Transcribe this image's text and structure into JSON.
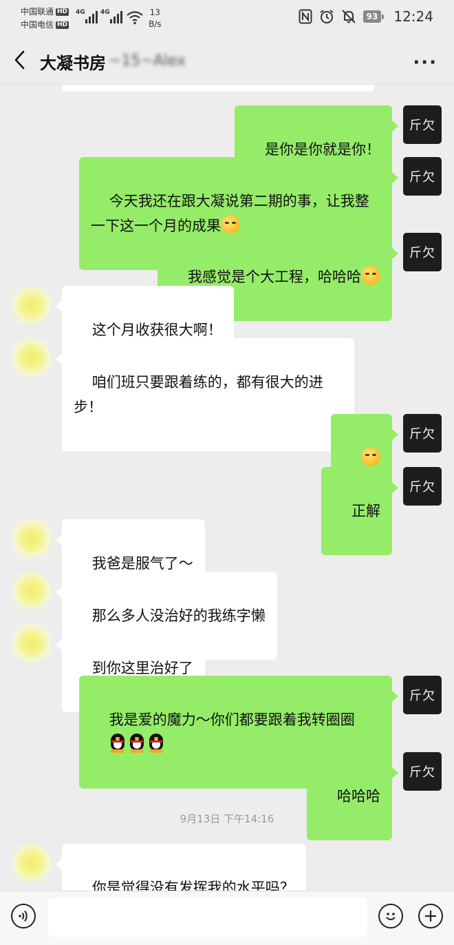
{
  "status_bar": {
    "carrier_1": "中国联通",
    "carrier_2": "中国电信",
    "hd_badge": "HD",
    "network_1": "4G",
    "network_2": "4G",
    "net_speed_value": "13",
    "net_speed_unit": "B/s",
    "battery": "93",
    "time": "12:24"
  },
  "header": {
    "title": "大凝书房",
    "title_suffix_blurred": "~15~Alex",
    "more_label": "···"
  },
  "messages": [
    {
      "side": "me",
      "text": "是你是你就是你！"
    },
    {
      "side": "me",
      "text": "今天我还在跟大凝说第二期的事，让我整一下这一个月的成果",
      "emoji": "thinking-face"
    },
    {
      "side": "me",
      "text": "我感觉是个大工程，哈哈哈",
      "emoji": "laughing-tears-face"
    },
    {
      "side": "them",
      "text": "这个月收获很大啊！"
    },
    {
      "side": "them",
      "text": "咱们班只要跟着练的，都有很大的进步！"
    },
    {
      "side": "me",
      "text": "",
      "emoji": "smirk-face x3"
    },
    {
      "side": "me",
      "text": "正解"
    },
    {
      "side": "them",
      "text": "我爸是服气了～",
      "emoji": "grin-face x3"
    },
    {
      "side": "them",
      "text": "那么多人没治好的我练字懒"
    },
    {
      "side": "them",
      "text": "到你这里治好了"
    },
    {
      "side": "me",
      "text": "我是爱的魔力～你们都要跟着我转圈圈",
      "emoji": "penguin x3"
    },
    {
      "side": "me",
      "text": "哈哈哈"
    },
    {
      "side": "them",
      "text": "你是觉得没有发挥我的水平吗？"
    }
  ],
  "timestamp": "9月13日 下午14:16",
  "my_avatar_text": "斤欠",
  "input": {
    "placeholder": "",
    "voice_icon": "voice-icon",
    "emoji_icon": "emoji-icon",
    "add_icon": "plus-icon"
  },
  "colors": {
    "background": "#ededed",
    "my_bubble": "#95ec69",
    "their_bubble": "#ffffff",
    "avatar_dark": "#1d1d1d"
  }
}
